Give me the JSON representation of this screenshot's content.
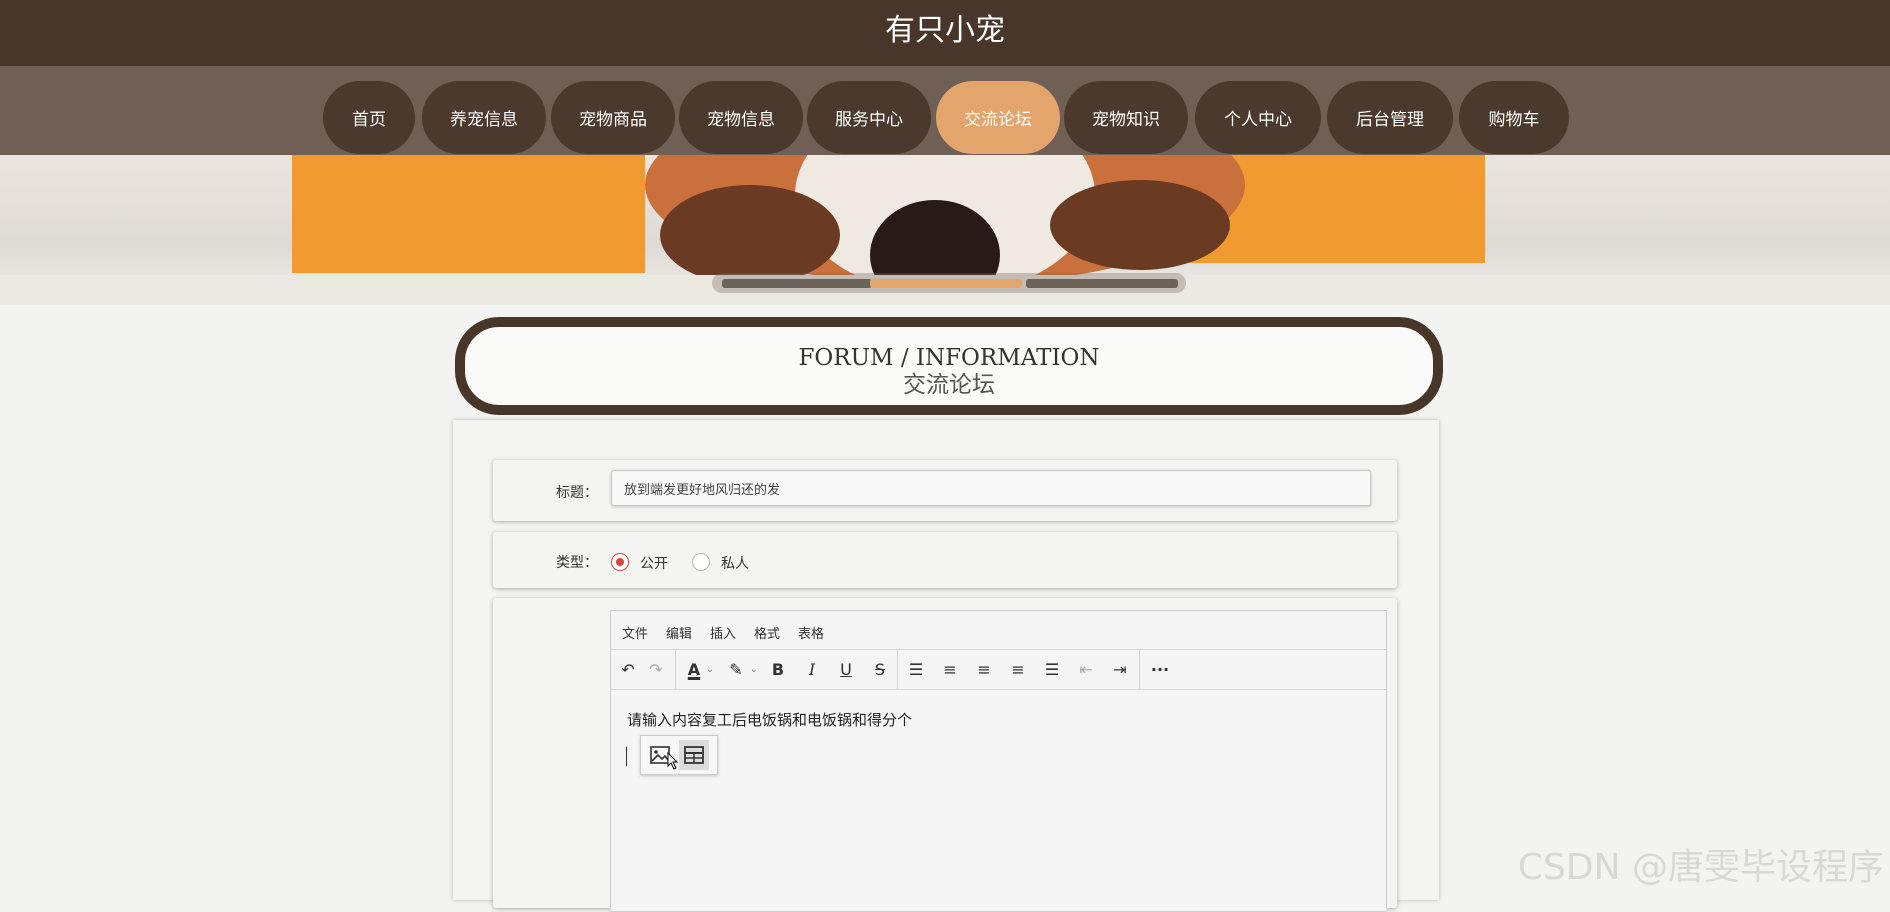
{
  "header": {
    "site_title": "有只小宠"
  },
  "nav": {
    "items": [
      {
        "label": "首页"
      },
      {
        "label": "养宠信息"
      },
      {
        "label": "宠物商品"
      },
      {
        "label": "宠物信息"
      },
      {
        "label": "服务中心"
      },
      {
        "label": "交流论坛",
        "active": true
      },
      {
        "label": "宠物知识"
      },
      {
        "label": "个人中心"
      },
      {
        "label": "后台管理"
      },
      {
        "label": "购物车"
      }
    ]
  },
  "banner": {
    "active_slide": 2,
    "slide_count": 3
  },
  "section": {
    "title_en": "FORUM / INFORMATION",
    "title_cn": "交流论坛"
  },
  "form": {
    "title_label": "标题：",
    "title_value": "放到端发更好地风归还的发",
    "type_label": "类型：",
    "type_options": [
      {
        "label": "公开",
        "checked": true
      },
      {
        "label": "私人",
        "checked": false
      }
    ]
  },
  "editor": {
    "menu": [
      "文件",
      "编辑",
      "插入",
      "格式",
      "表格"
    ],
    "content": "请输入内容复工后电饭锅和电饭锅和得分个",
    "toolbar": [
      "undo-icon",
      "redo-icon",
      "font-color-icon",
      "highlight-icon",
      "bold-icon",
      "italic-icon",
      "underline-icon",
      "strikethrough-icon",
      "list-icon",
      "align-left-icon",
      "align-center-icon",
      "align-right-icon",
      "justify-icon",
      "outdent-icon",
      "indent-icon",
      "more-icon"
    ],
    "quick_insert": [
      "image-icon",
      "table-icon"
    ]
  },
  "watermark": "CSDN @唐雯毕设程序",
  "colors": {
    "dark_brown": "#49362a",
    "nav_bg": "#705f55",
    "accent": "#e3a56c",
    "radio": "#d6453b"
  }
}
